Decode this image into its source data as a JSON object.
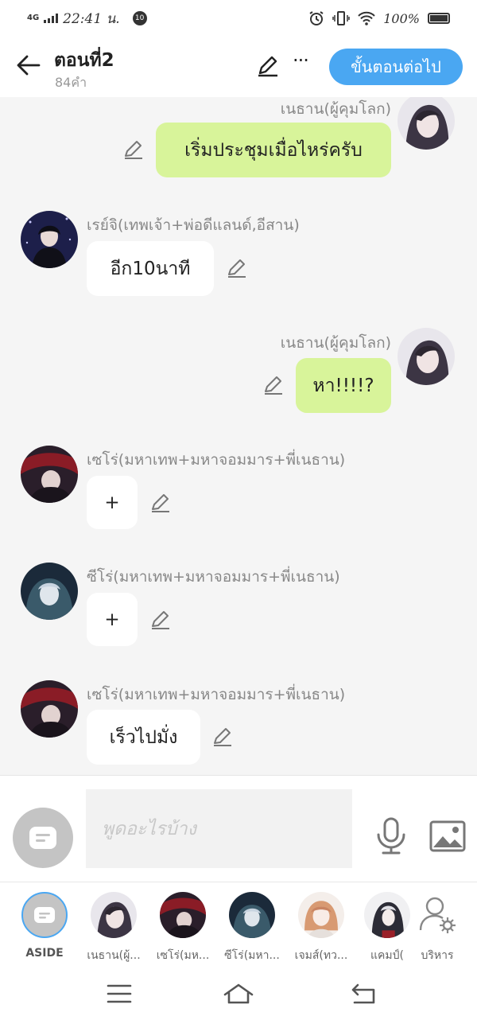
{
  "status_bar": {
    "network": "4G",
    "time": "22:41 น.",
    "notification": "10",
    "battery": "100%"
  },
  "header": {
    "title": "ตอนที่2",
    "word_count": "84คำ",
    "next_label": "ขั้นตอนต่อไป",
    "more_label": "···"
  },
  "messages": [
    {
      "sender": "เนธาน(ผู้คุมโลก)",
      "text": "เริ่มประชุมเมื่อไหร่ครับ",
      "side": "right",
      "avatar": "nathan"
    },
    {
      "sender": "เรย์จิ(เทพเจ้า+พ่อดีแลนด์,อีสาน)",
      "text": "อีก10นาที",
      "side": "left",
      "avatar": "reiji"
    },
    {
      "sender": "เนธาน(ผู้คุมโลก)",
      "text": "หา!!!!?",
      "side": "right",
      "avatar": "nathan"
    },
    {
      "sender": "เซโร่(มหาเทพ+มหาจอมมาร+พี่เนธาน)",
      "text": "+",
      "side": "left",
      "avatar": "zero"
    },
    {
      "sender": "ซีโร่(มหาเทพ+มหาจอมมาร+พี่เนธาน)",
      "text": "+",
      "side": "left",
      "avatar": "ziro"
    },
    {
      "sender": "เซโร่(มหาเทพ+มหาจอมมาร+พี่เนธาน)",
      "text": "เร็วไปมั่ง",
      "side": "left",
      "avatar": "zero"
    }
  ],
  "input": {
    "placeholder": "พูดอะไรบ้าง"
  },
  "characters": [
    {
      "name": "ASIDE",
      "avatar": "aside"
    },
    {
      "name": "เนธาน(ผู้...",
      "avatar": "nathan"
    },
    {
      "name": "เซโร่(มห...",
      "avatar": "zero"
    },
    {
      "name": "ซีโร่(มหา...",
      "avatar": "ziro"
    },
    {
      "name": "เจมส์(ทว...",
      "avatar": "james"
    },
    {
      "name": "แคมป์(",
      "avatar": "camp"
    },
    {
      "name": "บริหาร",
      "avatar": "manage"
    }
  ],
  "colors": {
    "accent": "#4aa7f2",
    "my_bubble": "#d8f49a",
    "other_bubble": "#ffffff",
    "background": "#f5f5f5"
  }
}
